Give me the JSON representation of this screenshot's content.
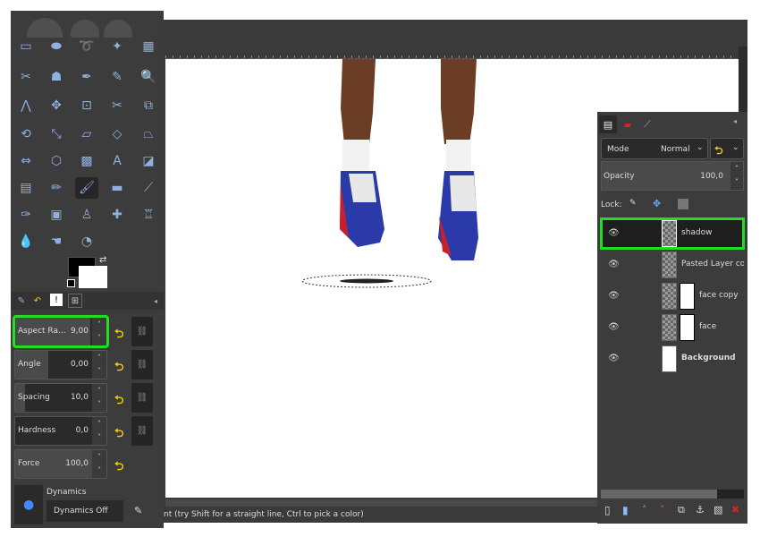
{
  "toolbox": {
    "tools": [
      {
        "icon": "rect-select-icon",
        "glyph": "▭"
      },
      {
        "icon": "ellipse-select-icon",
        "glyph": "⬬"
      },
      {
        "icon": "free-select-icon",
        "glyph": "➰"
      },
      {
        "icon": "fuzzy-select-icon",
        "glyph": "✦"
      },
      {
        "icon": "select-by-color-icon",
        "glyph": "▦"
      },
      {
        "icon": "scissors-select-icon",
        "glyph": "✂"
      },
      {
        "icon": "foreground-select-icon",
        "glyph": "☗"
      },
      {
        "icon": "paths-icon",
        "glyph": "✒"
      },
      {
        "icon": "color-picker-icon",
        "glyph": "✎"
      },
      {
        "icon": "zoom-icon",
        "glyph": "🔍"
      },
      {
        "icon": "measure-icon",
        "glyph": "⋀"
      },
      {
        "icon": "move-icon",
        "glyph": "✥"
      },
      {
        "icon": "align-icon",
        "glyph": "⊡"
      },
      {
        "icon": "crop-icon",
        "glyph": "✂"
      },
      {
        "icon": "unified-transform-icon",
        "glyph": "⧉"
      },
      {
        "icon": "rotate-icon",
        "glyph": "⟲"
      },
      {
        "icon": "scale-icon",
        "glyph": "⤡"
      },
      {
        "icon": "shear-icon",
        "glyph": "▱"
      },
      {
        "icon": "perspective-icon",
        "glyph": "◇"
      },
      {
        "icon": "3d-transform-icon",
        "glyph": "⏢"
      },
      {
        "icon": "flip-icon",
        "glyph": "⇔"
      },
      {
        "icon": "cage-icon",
        "glyph": "⬡"
      },
      {
        "icon": "warp-icon",
        "glyph": "▩"
      },
      {
        "icon": "text-icon",
        "glyph": "A"
      },
      {
        "icon": "bucket-fill-icon",
        "glyph": "◪"
      },
      {
        "icon": "gradient-icon",
        "glyph": "▤"
      },
      {
        "icon": "pencil-icon",
        "glyph": "✏"
      },
      {
        "icon": "paintbrush-icon",
        "glyph": "🖌"
      },
      {
        "icon": "eraser-icon",
        "glyph": "▬"
      },
      {
        "icon": "airbrush-icon",
        "glyph": "⟋"
      },
      {
        "icon": "ink-icon",
        "glyph": "✑"
      },
      {
        "icon": "mypaint-brush-icon",
        "glyph": "▣"
      },
      {
        "icon": "clone-icon",
        "glyph": "♙"
      },
      {
        "icon": "heal-icon",
        "glyph": "✚"
      },
      {
        "icon": "perspective-clone-icon",
        "glyph": "♖"
      },
      {
        "icon": "blur-icon",
        "glyph": "💧"
      },
      {
        "icon": "smudge-icon",
        "glyph": "☚"
      },
      {
        "icon": "dodge-burn-icon",
        "glyph": "◔"
      }
    ],
    "active_tool": "paintbrush-icon",
    "fg_color": "#000000",
    "bg_color": "#ffffff"
  },
  "tool_options": {
    "fields": [
      {
        "label": "Aspect Ra...",
        "value": "9,00",
        "fill": 0.95,
        "highlighted": true
      },
      {
        "label": "Angle",
        "value": "0,00",
        "fill": 0.42
      },
      {
        "label": "Spacing",
        "value": "10,0",
        "fill": 0.12
      },
      {
        "label": "Hardness",
        "value": "0,0",
        "fill": 0.0
      },
      {
        "label": "Force",
        "value": "100,0",
        "fill": 1.0
      }
    ],
    "dynamics_label": "Dynamics",
    "dynamics_value": "Dynamics Off"
  },
  "status": {
    "text": "nt (try Shift for a straight line, Ctrl to pick a color)"
  },
  "layers": {
    "mode_label": "Mode",
    "mode_value": "Normal",
    "opacity_label": "Opacity",
    "opacity_value": "100,0",
    "lock_label": "Lock:",
    "items": [
      {
        "name": "shadow",
        "selected": true,
        "bold": false
      },
      {
        "name": "Pasted Layer copy",
        "bold": false
      },
      {
        "name": "face copy",
        "mask": true,
        "bold": false
      },
      {
        "name": "face",
        "mask": true,
        "bold": false
      },
      {
        "name": "Background",
        "bold": true
      }
    ]
  },
  "highlight_color": "#22dd22"
}
